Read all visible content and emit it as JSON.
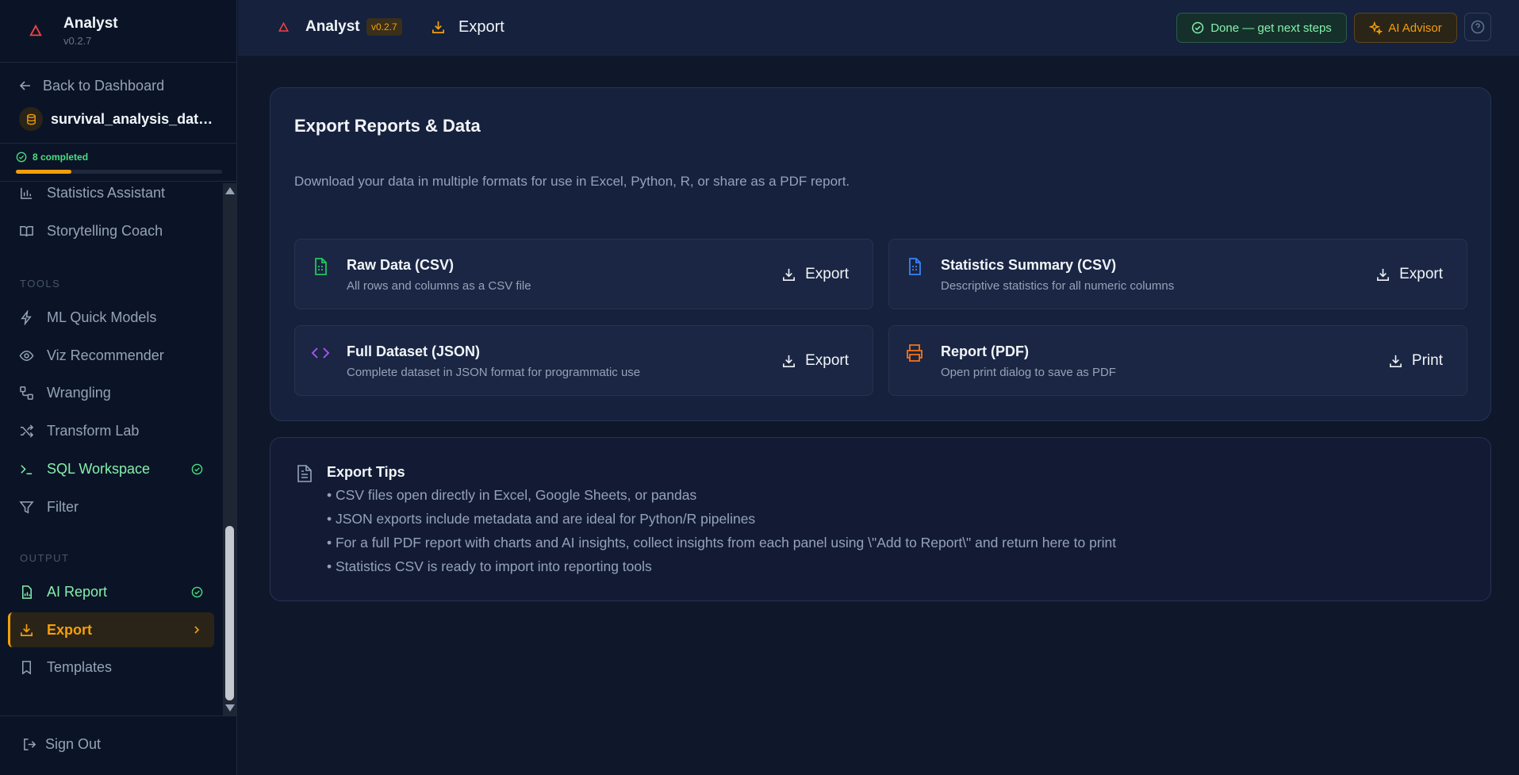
{
  "colors": {
    "accent": "#f59e0b",
    "success": "#4ade80",
    "bg": "#0f172a",
    "card": "#16213d"
  },
  "brand": {
    "name": "Analyst",
    "version": "v0.2.7"
  },
  "sidebar": {
    "back_label": "Back to Dashboard",
    "dataset_name": "survival_analysis_dataset.csv",
    "progress_label": "8 completed",
    "progress_fraction": 0.27,
    "items_top": [
      {
        "label": "Statistics Assistant",
        "icon": "bar-chart-icon",
        "done": false
      },
      {
        "label": "Storytelling Coach",
        "icon": "book-open-icon",
        "done": false
      }
    ],
    "tools_label": "TOOLS",
    "tools": [
      {
        "label": "ML Quick Models",
        "icon": "lightning-icon",
        "done": false
      },
      {
        "label": "Viz Recommender",
        "icon": "eye-icon",
        "done": false
      },
      {
        "label": "Wrangling",
        "icon": "workflow-icon",
        "done": false
      },
      {
        "label": "Transform Lab",
        "icon": "shuffle-icon",
        "done": false
      },
      {
        "label": "SQL Workspace",
        "icon": "terminal-icon",
        "done": true
      },
      {
        "label": "Filter",
        "icon": "filter-icon",
        "done": false
      }
    ],
    "output_label": "OUTPUT",
    "output": [
      {
        "label": "AI Report",
        "icon": "report-icon",
        "done": true
      },
      {
        "label": "Export",
        "icon": "download-icon",
        "active": true
      },
      {
        "label": "Templates",
        "icon": "bookmark-icon",
        "done": false
      }
    ],
    "signout_label": "Sign Out"
  },
  "topbar": {
    "app_name": "Analyst",
    "version": "v0.2.7",
    "page_title": "Export",
    "done_button": "Done — get next steps",
    "ai_button": "AI Advisor"
  },
  "main": {
    "title": "Export Reports & Data",
    "description": "Download your data in multiple formats for use in Excel, Python, R, or share as a PDF report.",
    "exports": [
      {
        "title": "Raw Data (CSV)",
        "subtitle": "All rows and columns as a CSV file",
        "button": "Export",
        "icon": "file-spreadsheet-icon",
        "icon_color": "#22c55e"
      },
      {
        "title": "Statistics Summary (CSV)",
        "subtitle": "Descriptive statistics for all numeric columns",
        "button": "Export",
        "icon": "file-spreadsheet-icon",
        "icon_color": "#3b82f6"
      },
      {
        "title": "Full Dataset (JSON)",
        "subtitle": "Complete dataset in JSON format for programmatic use",
        "button": "Export",
        "icon": "code-icon",
        "icon_color": "#a855f7"
      },
      {
        "title": "Report (PDF)",
        "subtitle": "Open print dialog to save as PDF",
        "button": "Print",
        "icon": "printer-icon",
        "icon_color": "#f97316"
      }
    ],
    "tips": {
      "title": "Export Tips",
      "lines": [
        "• CSV files open directly in Excel, Google Sheets, or pandas",
        "• JSON exports include metadata and are ideal for Python/R pipelines",
        "• For a full PDF report with charts and AI insights, collect insights from each panel using \\\"Add to Report\\\" and return here to print",
        "• Statistics CSV is ready to import into reporting tools"
      ]
    }
  }
}
